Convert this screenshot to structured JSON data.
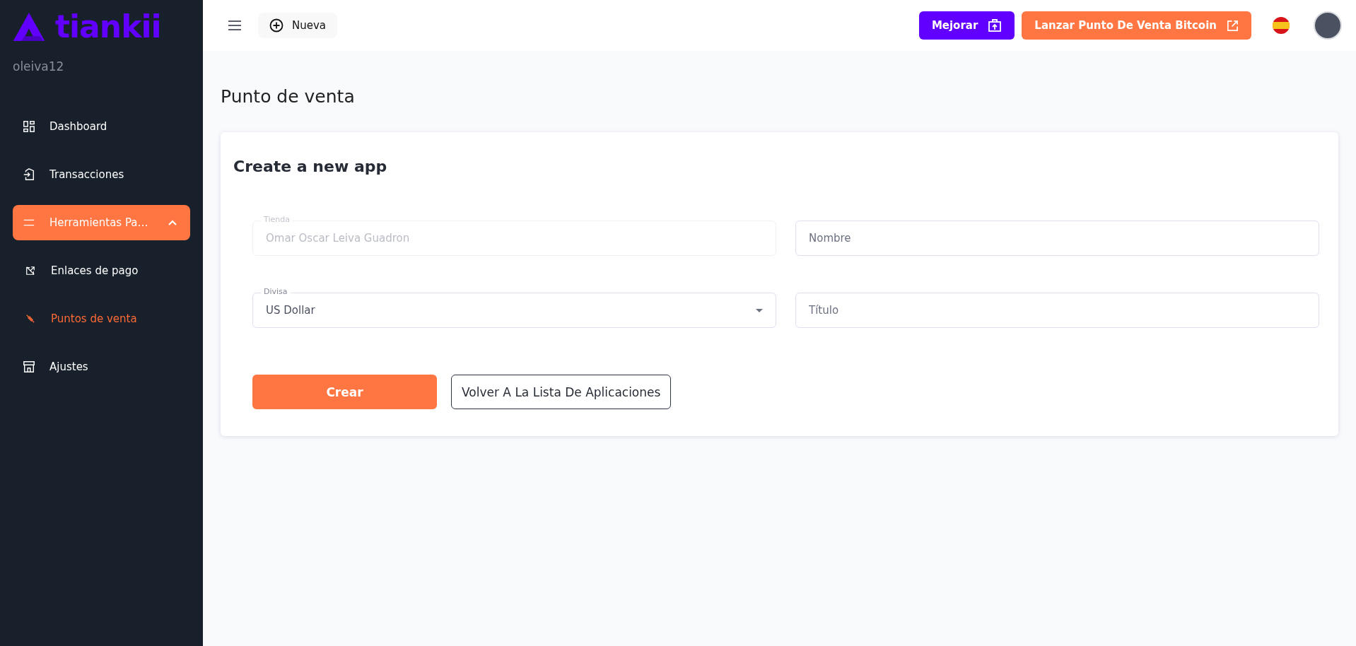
{
  "sidebar": {
    "logo": "tiankii",
    "username": "oleiva12",
    "items": [
      {
        "label": "Dashboard",
        "selected": false
      },
      {
        "label": "Transacciones",
        "selected": false
      },
      {
        "label": "Herramientas Pa…",
        "selected": true,
        "expanded": true,
        "children": [
          {
            "label": "Enlaces de pago",
            "selected": false
          },
          {
            "label": "Puntos de venta",
            "selected": true
          }
        ]
      },
      {
        "label": "Ajustes",
        "selected": false
      }
    ]
  },
  "topbar": {
    "new_button": "Nueva",
    "upgrade_button": "Mejorar",
    "launch_button": "Lanzar Punto De Venta Bitcoin"
  },
  "page_title": "Punto de venta",
  "form": {
    "title": "Create a new app",
    "fields": [
      {
        "kind": "input",
        "label": "Tienda",
        "value": "Omar Oscar Leiva Guadron",
        "disabled": true
      },
      {
        "kind": "input",
        "placeholder": "Nombre",
        "disabled": false
      },
      {
        "kind": "select",
        "label": "Divisa",
        "value": "US Dollar",
        "disabled": false
      },
      {
        "kind": "input",
        "placeholder": "Título",
        "disabled": false
      }
    ],
    "submit_button": "Crear",
    "back_button": "Volver A La Lista De Aplicaciones"
  }
}
